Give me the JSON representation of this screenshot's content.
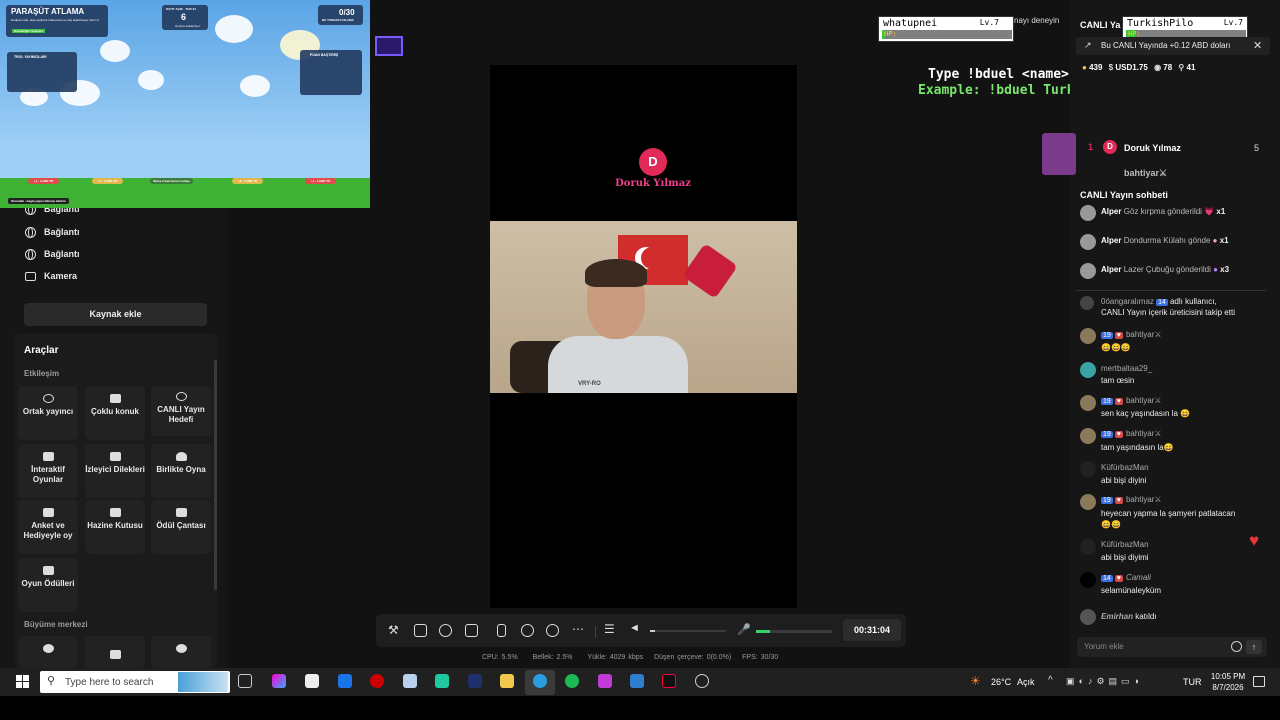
{
  "game": {
    "title": "PARAŞÜT ATLAMA",
    "subtitle": "Hediyeni çek, ekip seçilince kulla para ve maç keşfetmeye hazır ol",
    "goal_label": "Gönderiğin hediyeni",
    "counter_label": "KAYIT AÇIK · TUR 34",
    "counter_value": "6",
    "counter_sub": "Oyuncu bekleniyor",
    "score": "0/30",
    "score_sub": "BU TURDAKİ ATLAMA",
    "left_panel_title": "TROL YAYIMCILARI",
    "right_panel_title": "PUAN BAŞTIRİŞİ",
    "zones": [
      "+1 · LAND TO",
      "+2 · LAND TO",
      "Skora 3 katı bonus hediye",
      "+2 · LAND TO",
      "+1 · LAND TO"
    ],
    "footer": "Otomatik · bagla yapıcı bilinme katılım"
  },
  "sidebar": {
    "sources": [
      "Bağlantı",
      "Bağlantı",
      "Bağlantı",
      "Kamera"
    ],
    "add_source": "Kaynak ekle",
    "tools_title": "Araçlar",
    "section_interaction": "Etkileşim",
    "tiles": [
      "Ortak yayıncı",
      "Çoklu konuk",
      "CANLI Yayın Hedefi",
      "İnteraktif Oyunlar",
      "İzleyici Dilekleri",
      "Birlikte Oyna",
      "Anket ve Hediyeyle oy",
      "Hazine Kutusu",
      "Ödül Çantası",
      "Oyun Ödülleri"
    ],
    "section_growth": "Büyüme merkezi"
  },
  "stream": {
    "initial": "D",
    "name": "Doruk Yılmaz",
    "shirt_text": "VRY-RO",
    "overlay_line1": "Type !bduel <name> to play",
    "overlay_line2": "Example: !bduel TurkishPilot"
  },
  "hp_boxes": [
    {
      "name": "whatupnei",
      "level": "Lv.7",
      "hp_label": "HP:",
      "hp": 0.02
    },
    {
      "name": "TurkishPilo",
      "level": "Lv.7",
      "hp_label": "HP:",
      "hp": 0.08
    }
  ],
  "controls": {
    "timer": "00:31:04",
    "volume": 0.07,
    "mic_level": 0.18,
    "stats": {
      "cpu": "CPU: 5.5%",
      "memory": "Bellek: 2.5%",
      "upload": "Yükle: 4029 kbps",
      "dropped": "Düşen çerçeve: 0(0.0%)",
      "fps": "FPS: 30/30"
    }
  },
  "right": {
    "header_title": "CANLI Ya",
    "header_hint": "nayı deneyin",
    "toast": "Bu CANLI Yayında +0.12 ABD doları",
    "stats": {
      "coins": "439",
      "usd": "USD1.75",
      "viewers": "78",
      "followers": "41"
    },
    "ranking": [
      {
        "rank": "1",
        "initial": "D",
        "name": "Doruk Yılmaz",
        "score": "5"
      },
      {
        "rank": "2",
        "initial": "",
        "name": "bahtiyar⚔",
        "score": ""
      }
    ],
    "chat_title": "CANLI Yayın sohbeti",
    "gifts": [
      {
        "user": "Alper",
        "text": "Göz kırpma gönderildi",
        "count": "x1"
      },
      {
        "user": "Alper",
        "text": "Dondurma Külahı gönde",
        "count": "x1"
      },
      {
        "user": "Alper",
        "text": "Lazer Çubuğu gönderildi",
        "count": "x3"
      }
    ],
    "follow_user": "0öangaralımaz",
    "follow_badge": "14",
    "follow_line1": "adlı kullanıcı,",
    "follow_line2": "CANLI Yayın içerik üreticisini takip etti",
    "messages": [
      {
        "user": "bahtiyar⚔",
        "badge": "19",
        "text": "😄😄😄"
      },
      {
        "user": "mertbaltaa29_",
        "badge": "",
        "text": "tam œsin"
      },
      {
        "user": "bahtiyar⚔",
        "badge": "19",
        "text": "sen kaç yaşındasın la 😄"
      },
      {
        "user": "bahtiyar⚔",
        "badge": "19",
        "text": "tam yaşındasın la😄"
      },
      {
        "user": "KüfürbazMan",
        "badge": "",
        "text": "abi bişi diyini"
      },
      {
        "user": "bahtiyar⚔",
        "badge": "19",
        "text": "heyecan yapma la şamyeri patlatacan"
      },
      {
        "user": "",
        "badge": "",
        "text": "😄😄"
      },
      {
        "user": "KüfürbazMan",
        "badge": "",
        "text": "abi bişi diyimi"
      },
      {
        "user": "Camali",
        "badge": "14",
        "text": "selamünaleyküm"
      }
    ],
    "join_user": "Emirhan",
    "join_text": "katıldı",
    "comment_placeholder": "Yorum ekle"
  },
  "taskbar": {
    "search_placeholder": "Type here to search",
    "weather": "26°C",
    "weather_desc": "Açık",
    "lang": "TUR",
    "time": "10:05 PM",
    "date": "8/7/2026"
  },
  "colors": {
    "accent_red": "#e02a58",
    "grass": "#3fb135",
    "sky": "#7ab9ef",
    "badge_blue": "#3d6ee0"
  }
}
